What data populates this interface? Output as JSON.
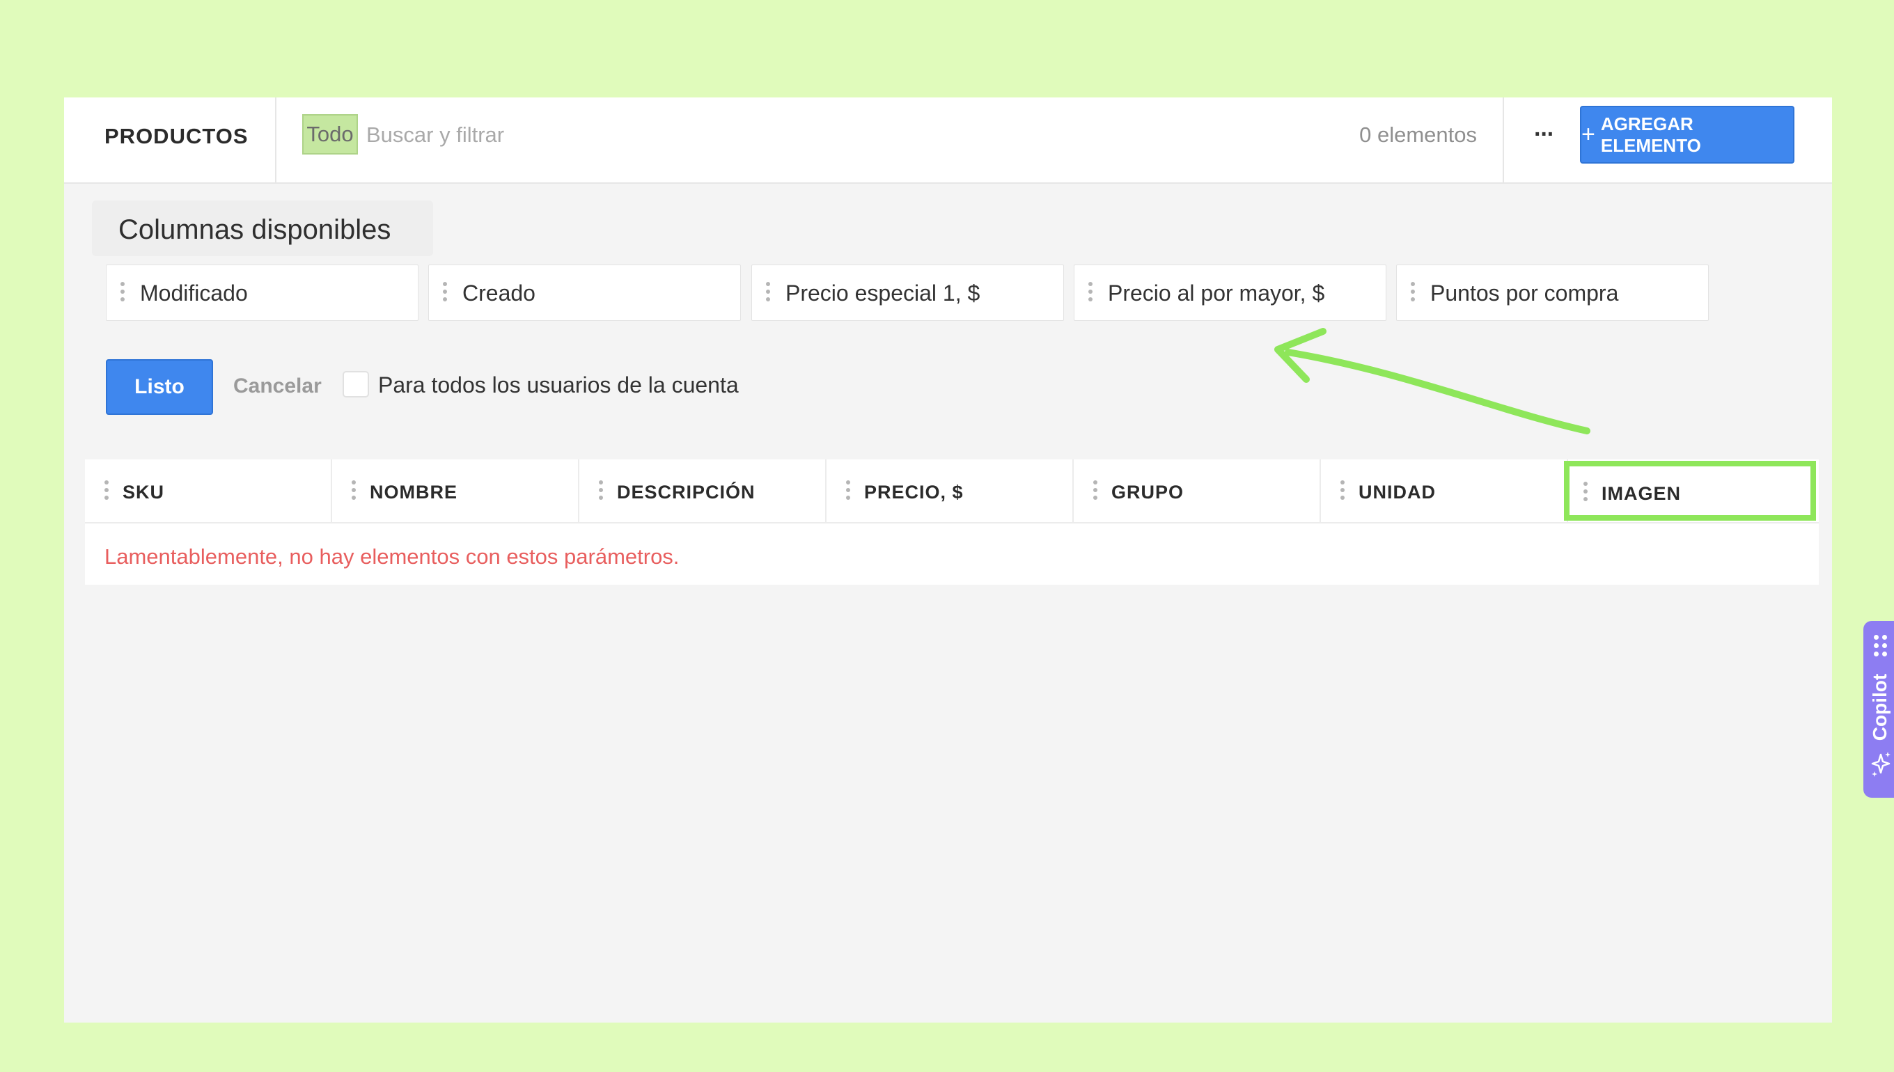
{
  "header": {
    "section_title": "PRODUCTOS",
    "filter_chip": "Todo",
    "search_placeholder": "Buscar y filtrar",
    "item_count": "0 elementos",
    "more_label": "···",
    "add_button": "AGREGAR ELEMENTO",
    "add_button_icon": "+"
  },
  "available_columns": {
    "title": "Columnas disponibles",
    "items": [
      {
        "label": "Modificado"
      },
      {
        "label": "Creado"
      },
      {
        "label": "Precio especial 1, $"
      },
      {
        "label": "Precio al por mayor, $"
      },
      {
        "label": "Puntos por compra"
      }
    ]
  },
  "actions": {
    "done": "Listo",
    "cancel": "Cancelar",
    "all_users_label": "Para todos los usuarios de la cuenta",
    "all_users_checked": false
  },
  "table": {
    "columns": [
      {
        "label": "SKU"
      },
      {
        "label": "NOMBRE"
      },
      {
        "label": "DESCRIPCIÓN"
      },
      {
        "label": "PRECIO, $"
      },
      {
        "label": "GRUPO"
      },
      {
        "label": "UNIDAD"
      },
      {
        "label": "IMAGEN",
        "highlighted": true
      }
    ],
    "empty_message": "Lamentablemente, no hay elementos con estos parámetros."
  },
  "copilot": {
    "label": "Copilot"
  },
  "colors": {
    "background": "#e0fbbb",
    "primary_button": "#3f87ee",
    "highlight": "#8ee65a",
    "error_text": "#e85e5e",
    "copilot": "#8d7df2"
  }
}
